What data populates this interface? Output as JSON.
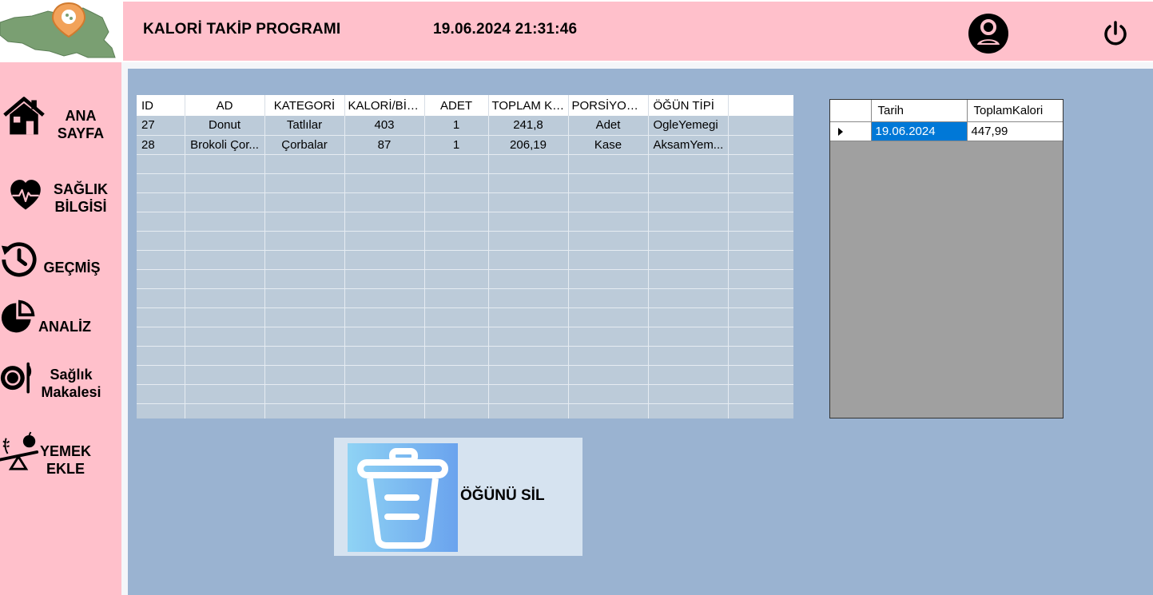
{
  "header": {
    "title": "KALORİ TAKİP PROGRAMI",
    "datetime": "19.06.2024 21:31:46"
  },
  "icons": {
    "logo": "map-pin-logo",
    "user": "user-account-icon",
    "power": "power-icon"
  },
  "sidebar": {
    "items": [
      {
        "label": "ANA\nSAYFA",
        "icon": "house-icon"
      },
      {
        "label": "SAĞLIK\nBİLGİSİ",
        "icon": "heart-pulse-icon"
      },
      {
        "label": "GEÇMİŞ",
        "icon": "history-icon"
      },
      {
        "label": "ANALİZ",
        "icon": "pie-chart-icon"
      },
      {
        "label": "Sağlık\nMakalesi",
        "icon": "plate-cutlery-icon"
      },
      {
        "label": "YEMEK\nEKLE",
        "icon": "balance-scale-icon"
      }
    ]
  },
  "meals_table": {
    "columns": [
      "ID",
      "AD",
      "KATEGORİ",
      "KALORİ/BİR...",
      "ADET",
      "TOPLAM KA...",
      "PORSİYON ...",
      "ÖĞÜN TİPİ"
    ],
    "rows": [
      [
        "27",
        "Donut",
        "Tatlılar",
        "403",
        "1",
        "241,8",
        "Adet",
        "OgleYemegi"
      ],
      [
        "28",
        "Brokoli Çor...",
        "Çorbalar",
        "87",
        "1",
        "206,19",
        "Kase",
        "AksamYem..."
      ]
    ]
  },
  "summary_table": {
    "columns": [
      "Tarih",
      "ToplamKalori"
    ],
    "rows": [
      [
        "19.06.2024",
        "447,99"
      ]
    ]
  },
  "delete_button": {
    "label": "ÖĞÜNÜ SİL",
    "icon": "trash-icon"
  },
  "colors": {
    "pink": "#ffc0cb",
    "main_bg": "#9ab3d1",
    "grid_bg": "#bccbd9",
    "selection": "#0078d7"
  }
}
